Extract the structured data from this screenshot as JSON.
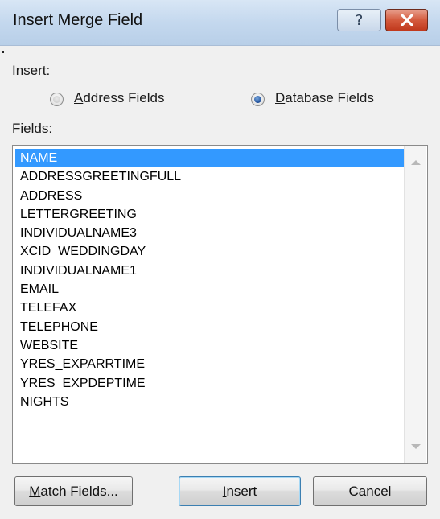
{
  "window": {
    "title": "Insert Merge Field",
    "help_glyph": "?",
    "close_icon": "close-x-icon"
  },
  "insert": {
    "label": "Insert:",
    "options": [
      {
        "label": "Address Fields",
        "selected": false
      },
      {
        "label": "Database Fields",
        "selected": true
      }
    ]
  },
  "fields": {
    "label": "Fields:",
    "items": [
      "NAME",
      "ADDRESSGREETINGFULL",
      "ADDRESS",
      "LETTERGREETING",
      "INDIVIDUALNAME3",
      "XCID_WEDDINGDAY",
      "INDIVIDUALNAME1",
      "EMAIL",
      "TELEFAX",
      "TELEPHONE",
      "WEBSITE",
      "YRES_EXPARRTIME",
      "YRES_EXPDEPTIME",
      "NIGHTS"
    ],
    "selected_index": 0
  },
  "buttons": {
    "match_fields": "Match Fields...",
    "insert": "Insert",
    "cancel": "Cancel"
  },
  "colors": {
    "selection": "#3399ff",
    "close_button": "#c0381c",
    "titlebar": "#c4d8ee"
  }
}
